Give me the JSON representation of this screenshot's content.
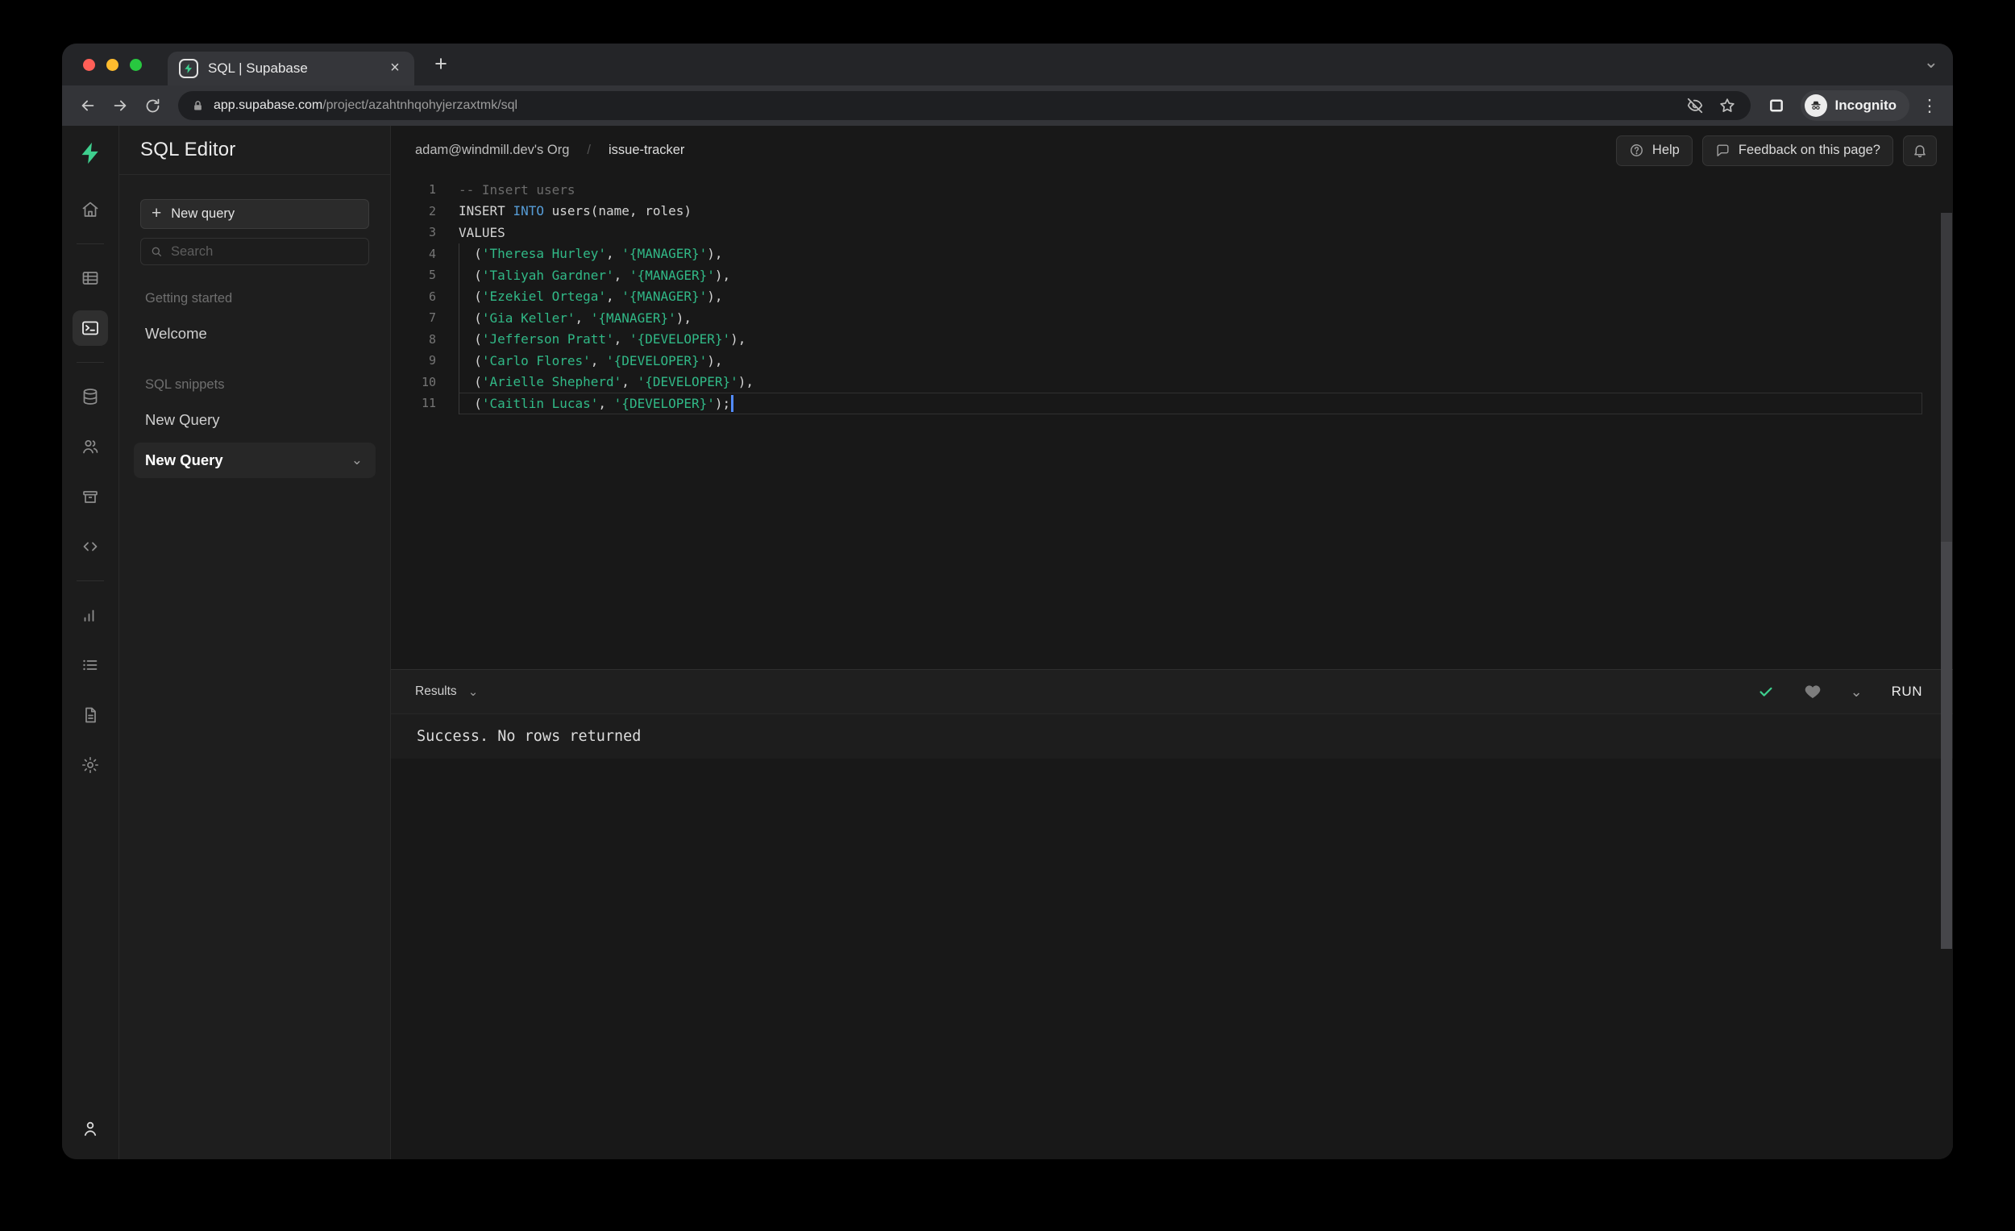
{
  "browser": {
    "tab_title": "SQL | Supabase",
    "url_host": "app.supabase.com",
    "url_path": "/project/azahtnhqohyjerzaxtmk/sql",
    "incognito_label": "Incognito"
  },
  "icons": {
    "plus": "+",
    "close": "×",
    "kebab": "⋮",
    "chevron_down": "⌄"
  },
  "nav_rail": {
    "active": "sql-editor",
    "items": [
      "home",
      "table-editor",
      "sql-editor",
      "database",
      "authentication",
      "storage",
      "edge-functions",
      "reports",
      "logs",
      "docs",
      "settings",
      "account"
    ]
  },
  "snippets_panel": {
    "title": "SQL Editor",
    "new_query_button": "New query",
    "search_placeholder": "Search",
    "sections": [
      {
        "label": "Getting started",
        "items": [
          {
            "label": "Welcome",
            "active": false
          }
        ]
      },
      {
        "label": "SQL snippets",
        "items": [
          {
            "label": "New Query",
            "active": false
          },
          {
            "label": "New Query",
            "active": true
          }
        ]
      }
    ]
  },
  "main_header": {
    "breadcrumb": {
      "org": "adam@windmill.dev's Org",
      "separator": "/",
      "project": "issue-tracker"
    },
    "help_button": "Help",
    "feedback_button": "Feedback on this page?"
  },
  "editor": {
    "lines": [
      {
        "num": 1,
        "segments": [
          {
            "t": "comment",
            "s": "-- Insert users"
          }
        ]
      },
      {
        "num": 2,
        "segments": [
          {
            "t": "plain",
            "s": "INSERT "
          },
          {
            "t": "keyword",
            "s": "INTO"
          },
          {
            "t": "plain",
            "s": " users(name, roles)"
          }
        ]
      },
      {
        "num": 3,
        "segments": [
          {
            "t": "plain",
            "s": "VALUES"
          }
        ]
      },
      {
        "num": 4,
        "guide": true,
        "segments": [
          {
            "t": "plain",
            "s": "  ("
          },
          {
            "t": "string",
            "s": "'Theresa Hurley'"
          },
          {
            "t": "plain",
            "s": ", "
          },
          {
            "t": "string",
            "s": "'{MANAGER}'"
          },
          {
            "t": "plain",
            "s": "),"
          }
        ]
      },
      {
        "num": 5,
        "guide": true,
        "segments": [
          {
            "t": "plain",
            "s": "  ("
          },
          {
            "t": "string",
            "s": "'Taliyah Gardner'"
          },
          {
            "t": "plain",
            "s": ", "
          },
          {
            "t": "string",
            "s": "'{MANAGER}'"
          },
          {
            "t": "plain",
            "s": "),"
          }
        ]
      },
      {
        "num": 6,
        "guide": true,
        "segments": [
          {
            "t": "plain",
            "s": "  ("
          },
          {
            "t": "string",
            "s": "'Ezekiel Ortega'"
          },
          {
            "t": "plain",
            "s": ", "
          },
          {
            "t": "string",
            "s": "'{MANAGER}'"
          },
          {
            "t": "plain",
            "s": "),"
          }
        ]
      },
      {
        "num": 7,
        "guide": true,
        "segments": [
          {
            "t": "plain",
            "s": "  ("
          },
          {
            "t": "string",
            "s": "'Gia Keller'"
          },
          {
            "t": "plain",
            "s": ", "
          },
          {
            "t": "string",
            "s": "'{MANAGER}'"
          },
          {
            "t": "plain",
            "s": "),"
          }
        ]
      },
      {
        "num": 8,
        "guide": true,
        "segments": [
          {
            "t": "plain",
            "s": "  ("
          },
          {
            "t": "string",
            "s": "'Jefferson Pratt'"
          },
          {
            "t": "plain",
            "s": ", "
          },
          {
            "t": "string",
            "s": "'{DEVELOPER}'"
          },
          {
            "t": "plain",
            "s": "),"
          }
        ]
      },
      {
        "num": 9,
        "guide": true,
        "segments": [
          {
            "t": "plain",
            "s": "  ("
          },
          {
            "t": "string",
            "s": "'Carlo Flores'"
          },
          {
            "t": "plain",
            "s": ", "
          },
          {
            "t": "string",
            "s": "'{DEVELOPER}'"
          },
          {
            "t": "plain",
            "s": "),"
          }
        ]
      },
      {
        "num": 10,
        "guide": true,
        "segments": [
          {
            "t": "plain",
            "s": "  ("
          },
          {
            "t": "string",
            "s": "'Arielle Shepherd'"
          },
          {
            "t": "plain",
            "s": ", "
          },
          {
            "t": "string",
            "s": "'{DEVELOPER}'"
          },
          {
            "t": "plain",
            "s": "),"
          }
        ]
      },
      {
        "num": 11,
        "guide": true,
        "current": true,
        "cursor": true,
        "segments": [
          {
            "t": "plain",
            "s": "  ("
          },
          {
            "t": "string",
            "s": "'Caitlin Lucas'"
          },
          {
            "t": "plain",
            "s": ", "
          },
          {
            "t": "string",
            "s": "'{DEVELOPER}'"
          },
          {
            "t": "plain",
            "s": ");"
          }
        ]
      }
    ]
  },
  "results": {
    "label": "Results",
    "run_button": "RUN",
    "message": "Success. No rows returned"
  },
  "colors": {
    "accent_green": "#3ecf8e",
    "string_green": "#31b987",
    "keyword_blue": "#569cd6",
    "cursor_blue": "#528bff"
  }
}
